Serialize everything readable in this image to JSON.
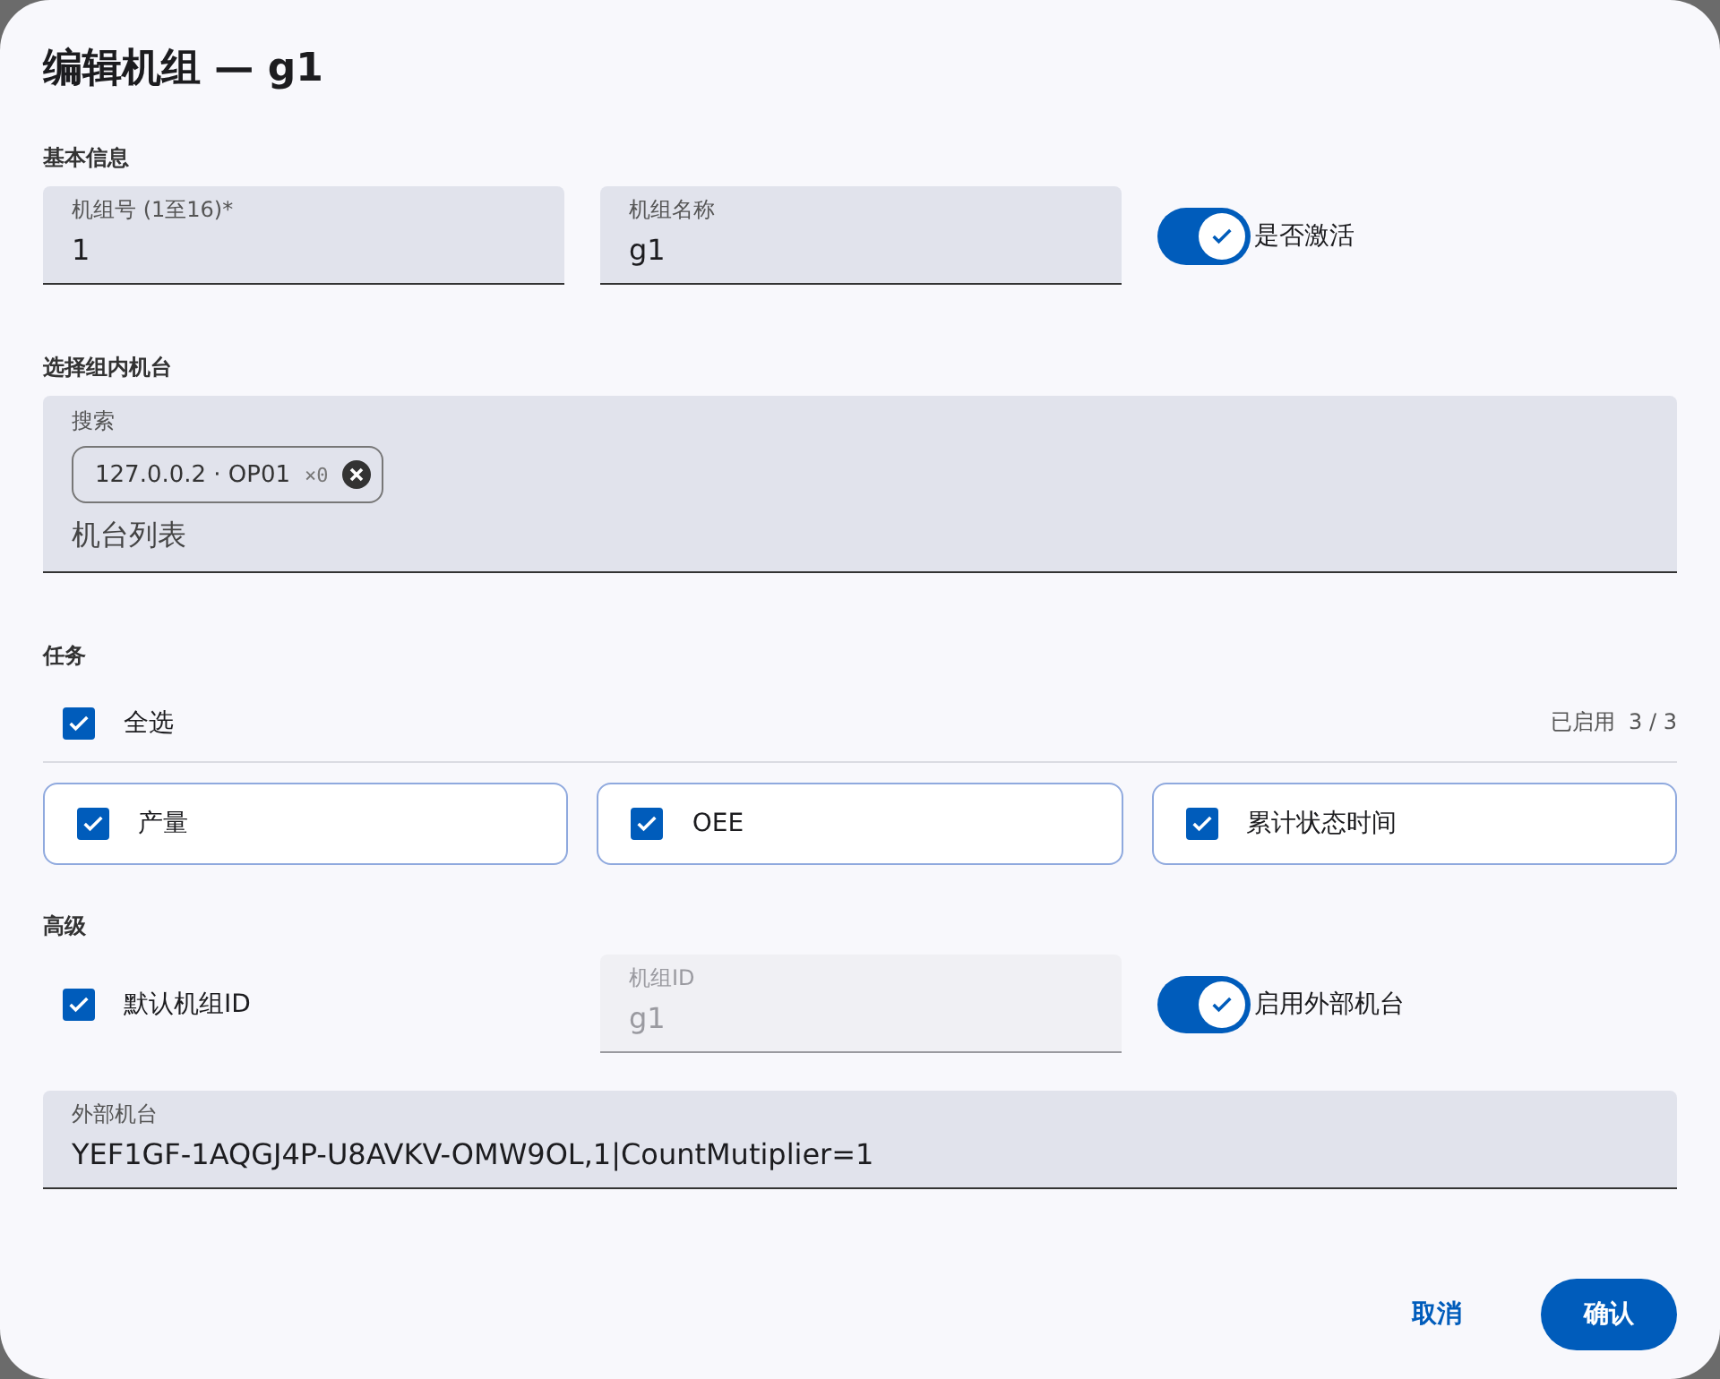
{
  "dialog": {
    "title": "编辑机组 — g1"
  },
  "basic": {
    "heading": "基本信息",
    "fields": [
      {
        "label": "机组号 (1至16)*",
        "value": "1"
      },
      {
        "label": "机组名称",
        "value": "g1"
      }
    ],
    "active_toggle": {
      "label": "是否激活",
      "on": true
    }
  },
  "machines": {
    "heading": "选择组内机台",
    "field": {
      "label": "搜索",
      "placeholder": "机台列表",
      "chips": [
        {
          "label": "127.0.0.2 · OP01",
          "count": "×0"
        }
      ]
    }
  },
  "tasks": {
    "heading": "任务",
    "select_all": {
      "label": "全选",
      "checked": true
    },
    "enabled_label": "已启用",
    "enabled_count": "3 / 3",
    "items": [
      {
        "label": "产量",
        "checked": true
      },
      {
        "label": "OEE",
        "checked": true
      },
      {
        "label": "累计状态时间",
        "checked": true
      }
    ]
  },
  "advanced": {
    "heading": "高级",
    "default_id": {
      "label": "默认机组ID",
      "checked": true
    },
    "group_id_field": {
      "label": "机组ID",
      "value": "g1",
      "disabled": true
    },
    "external_toggle": {
      "label": "启用外部机台",
      "on": true
    },
    "external_field": {
      "label": "外部机台",
      "value": "YEF1GF-1AQGJ4P-U8AVKV-OMW9OL,1|CountMutiplier=1"
    }
  },
  "buttons": [
    {
      "label": "取消",
      "kind": "text"
    },
    {
      "label": "确认",
      "kind": "primary"
    }
  ]
}
